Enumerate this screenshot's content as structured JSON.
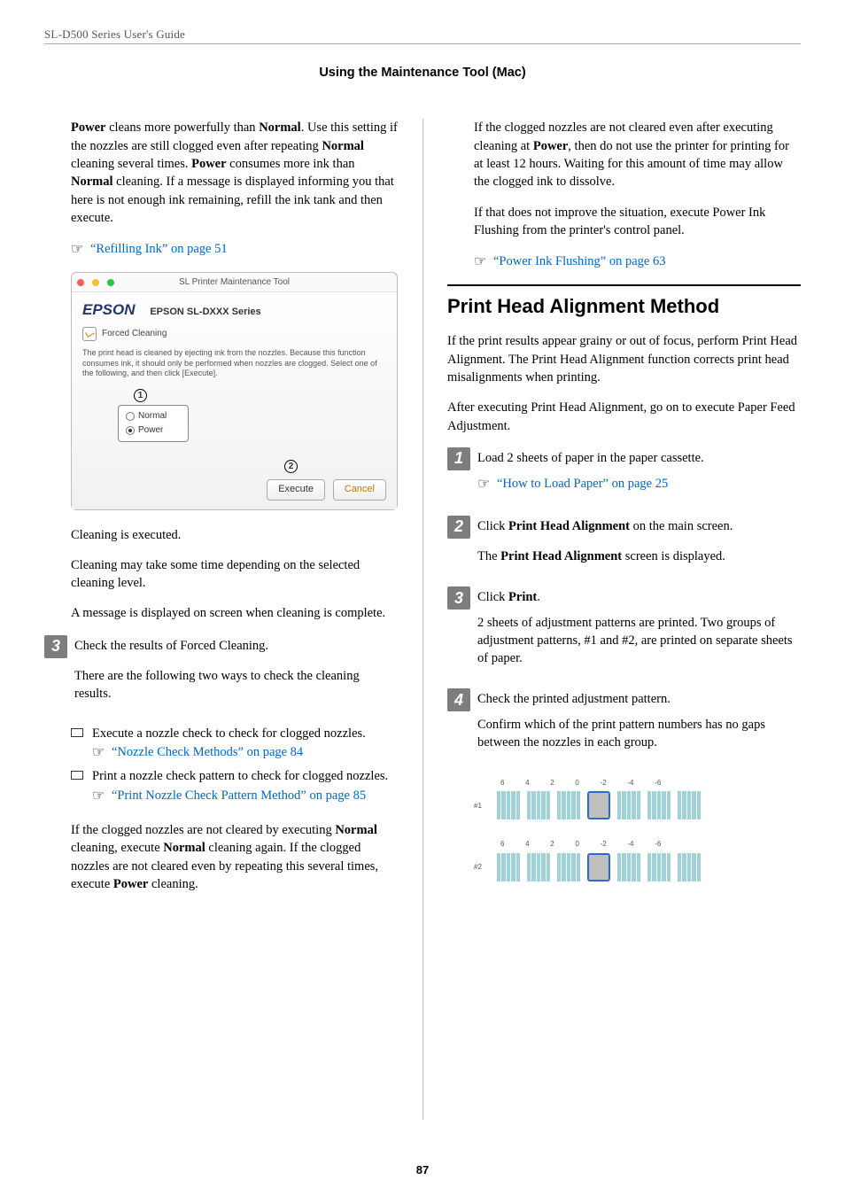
{
  "header": {
    "product_line": "SL-D500 Series     User's Guide",
    "section_title": "Using the Maintenance Tool (Mac)"
  },
  "left": {
    "para1_a": "Power",
    "para1_b": " cleans more powerfully than ",
    "para1_c": "Normal",
    "para1_d": ". Use this setting if the nozzles are still clogged even after repeating ",
    "para1_e": "Normal",
    "para1_f": " cleaning several times. ",
    "para1_g": "Power",
    "para1_h": " consumes more ink than ",
    "para1_i": "Normal",
    "para1_j": " cleaning. If a message is displayed informing you that here is not enough ink remaining, refill the ink tank and then execute.",
    "link_refill": "“Refilling Ink” on page 51",
    "ss": {
      "title": "SL Printer Maintenance Tool",
      "brand": "EPSON",
      "model": "EPSON SL-DXXX Series",
      "head": "Forced Cleaning",
      "desc": "The print head is cleaned by ejecting ink from the nozzles. Because this function consumes ink, it should only be performed when nozzles are clogged. Select one of the following, and then click [Execute].",
      "opt_normal": "Normal",
      "opt_power": "Power",
      "btn_execute": "Execute",
      "btn_cancel": "Cancel",
      "callout1": "1",
      "callout2": "2"
    },
    "after_ss_1": "Cleaning is executed.",
    "after_ss_2": "Cleaning may take some time depending on the selected cleaning level.",
    "after_ss_3": "A message is displayed on screen when cleaning is complete.",
    "step3_num": "3",
    "step3_title": "Check the results of Forced Cleaning.",
    "step3_body": "There are the following two ways to check the cleaning results.",
    "b1_text": "Execute a nozzle check to check for clogged nozzles.",
    "b1_link": "“Nozzle Check Methods” on page 84",
    "b2_text": "Print a nozzle check pattern to check for clogged nozzles.",
    "b2_link": "“Print Nozzle Check Pattern Method” on page 85",
    "para_last_a": "If the clogged nozzles are not cleared by executing ",
    "para_last_b": "Normal",
    "para_last_c": " cleaning, execute ",
    "para_last_d": "Normal",
    "para_last_e": " cleaning again. If the clogged nozzles are not cleared even by repeating this several times, execute ",
    "para_last_f": "Power",
    "para_last_g": " cleaning."
  },
  "right": {
    "p1_a": "If the clogged nozzles are not cleared even after executing cleaning at ",
    "p1_b": "Power",
    "p1_c": ", then do not use the printer for printing for at least 12 hours. Waiting for this amount of time may allow the clogged ink to dissolve.",
    "p2": "If that does not improve the situation, execute Power Ink Flushing from the printer's control panel.",
    "link_pif": "“Power Ink Flushing” on page 63",
    "h2": "Print Head Alignment Method",
    "intro1": "If the print results appear grainy or out of focus, perform Print Head Alignment. The Print Head Alignment function corrects print head misalignments when printing.",
    "intro2": "After executing Print Head Alignment, go on to execute Paper Feed Adjustment.",
    "s1_num": "1",
    "s1_text": "Load 2 sheets of paper in the paper cassette.",
    "s1_link": "“How to Load Paper” on page 25",
    "s2_num": "2",
    "s2_a": "Click ",
    "s2_b": "Print Head Alignment",
    "s2_c": " on the main screen.",
    "s2_d": "The ",
    "s2_e": "Print Head Alignment",
    "s2_f": " screen is displayed.",
    "s3_num": "3",
    "s3_a": "Click ",
    "s3_b": "Print",
    "s3_c": ".",
    "s3_body": "2 sheets of adjustment patterns are printed. Two groups of adjustment patterns, #1 and #2, are printed on separate sheets of paper.",
    "s4_num": "4",
    "s4_text": "Check the printed adjustment pattern.",
    "s4_body": "Confirm which of the print pattern numbers has no gaps between the nozzles in each group.",
    "pat_labels": [
      "6",
      "4",
      "2",
      "0",
      "-2",
      "-4",
      "-6"
    ],
    "pat_id1": "#1",
    "pat_id2": "#2"
  },
  "page_number": "87"
}
